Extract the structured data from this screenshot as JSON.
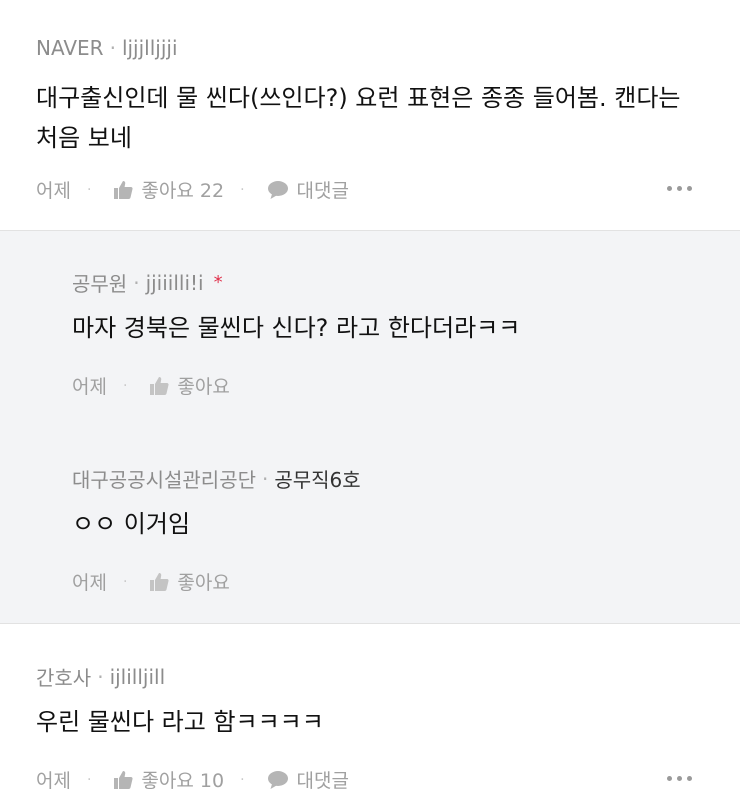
{
  "comments": [
    {
      "source": "NAVER",
      "handle": "ljjjlljjji",
      "text": "대구출신인데 물 씬다(쓰인다?) 요런 표현은 종종 들어봄. 캔다는 처음 보네",
      "time": "어제",
      "like_label": "좋아요 22",
      "reply_label": "대댓글",
      "more_icon": "more-icon"
    },
    {
      "source": "간호사",
      "handle": "ijlilljill",
      "text": "우린 물씬다 라고 함ㅋㅋㅋㅋ",
      "time": "어제",
      "like_label": "좋아요 10",
      "reply_label": "대댓글",
      "more_icon": "more-icon"
    }
  ],
  "replies": [
    {
      "source": "공무원",
      "handle": "jjiiilli!i",
      "badge": "*",
      "text": "마자 경북은 물씬다 신다? 라고 한다더라ㅋㅋ",
      "time": "어제",
      "like_label": "좋아요"
    },
    {
      "source": "대구공공시설관리공단",
      "handle": "공무직6호",
      "text": "ㅇㅇ 이거임",
      "time": "어제",
      "like_label": "좋아요"
    }
  ],
  "separator": "·",
  "colors": {
    "reply_background": "#f3f4f6",
    "meta_gray": "#8c8c8c",
    "badge_red": "#e0304b"
  }
}
